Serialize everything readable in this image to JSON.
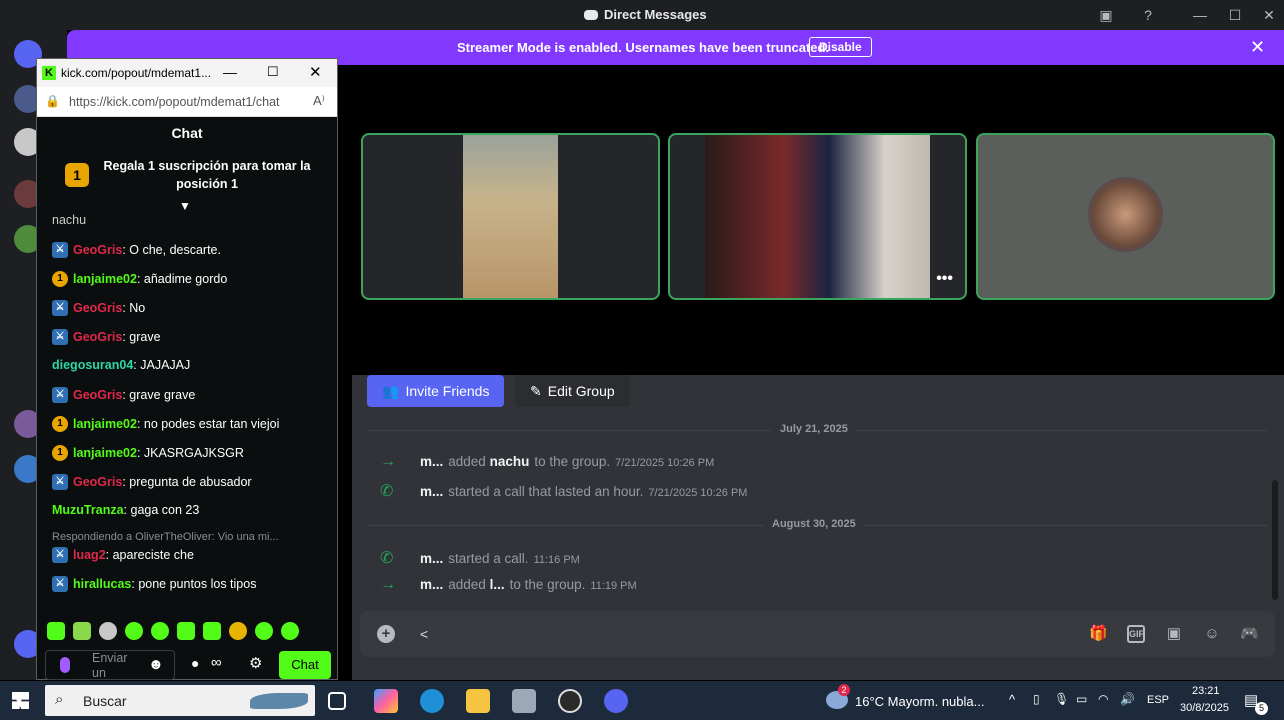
{
  "window": {
    "title": "Direct Messages"
  },
  "banner": {
    "text": "Streamer Mode is enabled. Usernames have been truncated.",
    "disable_label": "Disable"
  },
  "kick": {
    "tab_title": "kick.com/popout/mdemat1...",
    "url": "https://kick.com/popout/mdemat1/chat",
    "header": "Chat",
    "pinned_rank": "1",
    "pinned_text_1": "Regala 1 suscripción para tomar la",
    "pinned_text_2": "posición 1",
    "partial_top": "nachu",
    "messages": [
      {
        "user": "GeoGris",
        "color": "#e0284b",
        "badge": "mod",
        "text": ": O che, descarte."
      },
      {
        "user": "lanjaime02",
        "color": "#53fc18",
        "badge": "sub",
        "text": ": añadime gordo"
      },
      {
        "user": "GeoGris",
        "color": "#e0284b",
        "badge": "mod",
        "text": ": No"
      },
      {
        "user": "GeoGris",
        "color": "#e0284b",
        "badge": "mod",
        "text": ": grave"
      },
      {
        "user": "diegosuran04",
        "color": "#2ed8a3",
        "badge": "",
        "text": ": JAJAJAJ"
      },
      {
        "user": "GeoGris",
        "color": "#e0284b",
        "badge": "mod",
        "text": ": grave grave"
      },
      {
        "user": "lanjaime02",
        "color": "#53fc18",
        "badge": "sub",
        "text": ": no podes estar tan viejoi"
      },
      {
        "user": "lanjaime02",
        "color": "#53fc18",
        "badge": "sub",
        "text": ": JKASRGAJKSGR"
      },
      {
        "user": "GeoGris",
        "color": "#e0284b",
        "badge": "mod",
        "text": ": pregunta de abusador"
      },
      {
        "user": "MuzuTranza",
        "color": "#53fc18",
        "badge": "",
        "text": ": gaga con 23"
      }
    ],
    "reply_note": "Respondiendo a OliverTheOliver: Vio una mi...",
    "messages2": [
      {
        "user": "luag2",
        "color": "#e0284b",
        "badge": "mod",
        "text": ": apareciste che"
      },
      {
        "user": "hirallucas",
        "color": "#53fc18",
        "badge": "mod",
        "text": ": pone puntos los tipos"
      }
    ],
    "input_placeholder": "Enviar un",
    "send_label": "Chat"
  },
  "group": {
    "invite_label": "Invite Friends",
    "edit_label": "Edit Group"
  },
  "history": {
    "date1": "July 21, 2025",
    "date2": "August 30, 2025",
    "rows": [
      {
        "icon": "→",
        "user": "m...",
        "pre": "added",
        "target": "nachu",
        "post": "to the group.",
        "ts": "7/21/2025 10:26 PM"
      },
      {
        "icon": "✆",
        "user": "m...",
        "pre": "started a call that lasted an hour.",
        "target": "",
        "post": "",
        "ts": "7/21/2025 10:26 PM"
      },
      {
        "icon": "✆",
        "user": "m...",
        "pre": "started a call.",
        "target": "",
        "post": "",
        "ts": "11:16 PM"
      },
      {
        "icon": "→",
        "user": "m...",
        "pre": "added",
        "target": "l...",
        "post": "to the group.",
        "ts": "11:19 PM"
      }
    ]
  },
  "composer": {
    "placeholder": "<"
  },
  "taskbar": {
    "search_label": "Buscar",
    "weather": "16°C Mayorm. nubla...",
    "weather_badge": "2",
    "lang": "ESP",
    "time": "23:21",
    "date": "30/8/2025",
    "notif_count": "5"
  }
}
